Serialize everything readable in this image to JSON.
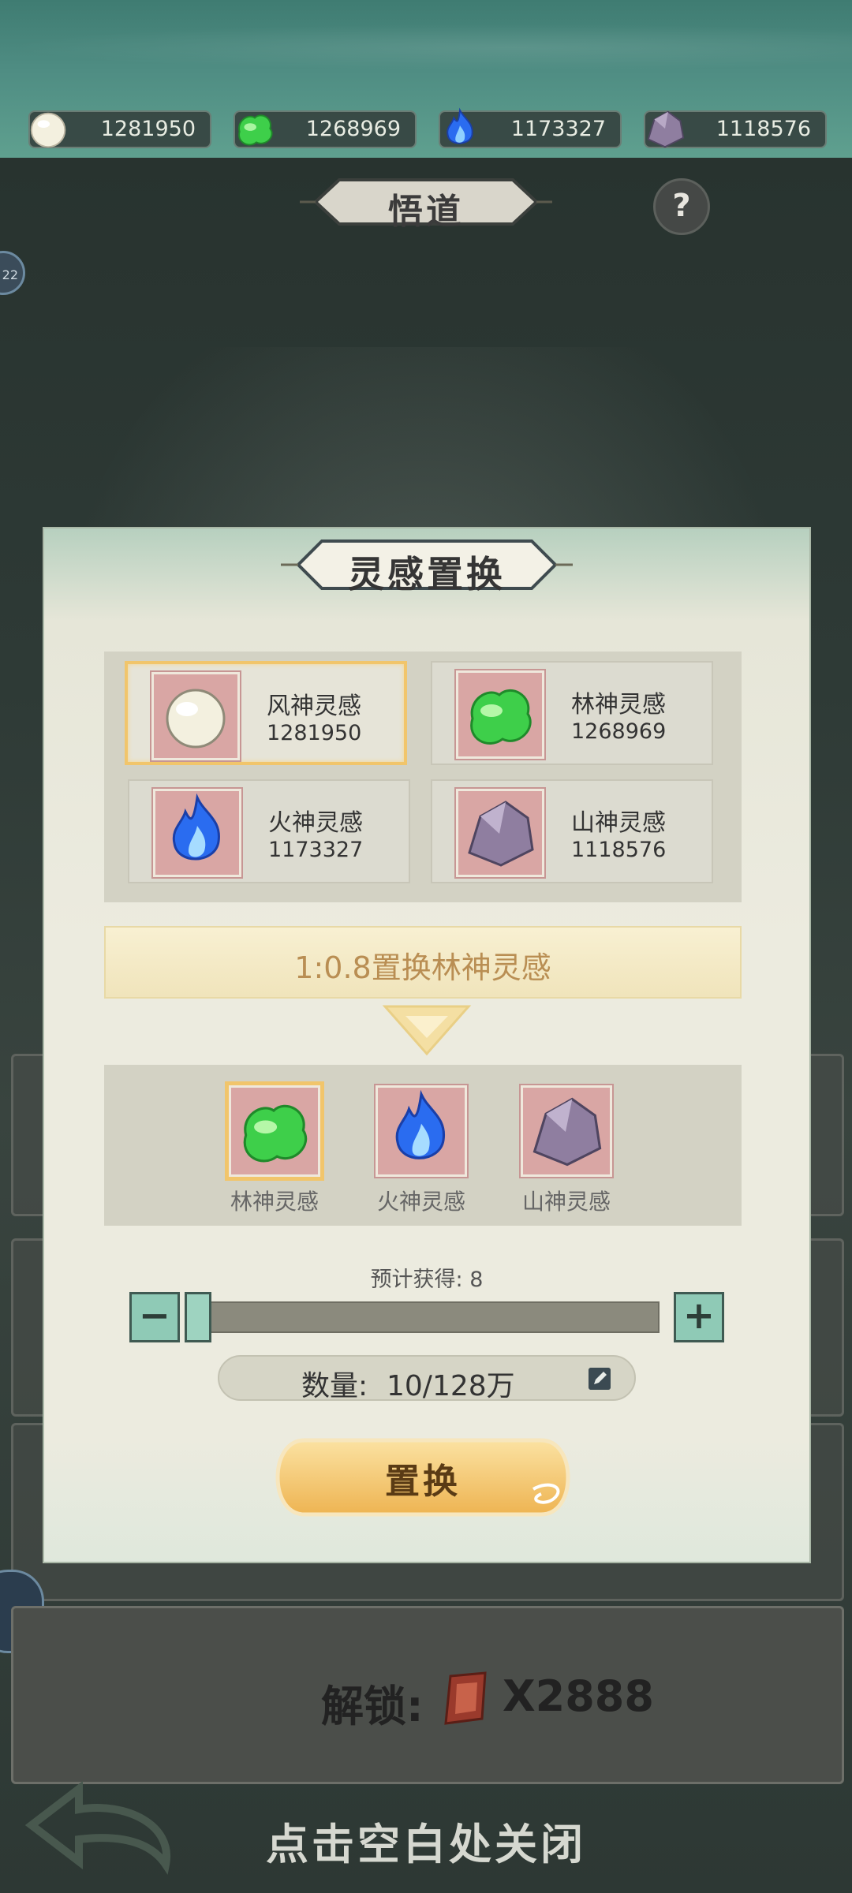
{
  "resources": [
    {
      "icon": "white-pearl-icon",
      "value": "1281950"
    },
    {
      "icon": "green-jade-icon",
      "value": "1268969"
    },
    {
      "icon": "blue-flame-icon",
      "value": "1173327"
    },
    {
      "icon": "purple-rock-icon",
      "value": "1118576"
    }
  ],
  "page": {
    "title": "悟道",
    "help_label": "?"
  },
  "modal": {
    "title": "灵感置换",
    "sources": [
      {
        "name": "风神灵感",
        "count": "1281950",
        "icon": "white-pearl-icon"
      },
      {
        "name": "林神灵感",
        "count": "1268969",
        "icon": "green-jade-icon"
      },
      {
        "name": "火神灵感",
        "count": "1173327",
        "icon": "blue-flame-icon"
      },
      {
        "name": "山神灵感",
        "count": "1118576",
        "icon": "purple-rock-icon"
      }
    ],
    "selected_source": 0,
    "rate_text": "1:0.8置换林神灵感",
    "targets": [
      {
        "name": "林神灵感",
        "icon": "green-jade-icon"
      },
      {
        "name": "火神灵感",
        "icon": "blue-flame-icon"
      },
      {
        "name": "山神灵感",
        "icon": "purple-rock-icon"
      }
    ],
    "selected_target": 0,
    "expected_label": "预计获得: 8",
    "minus_label": "−",
    "plus_label": "+",
    "quantity_label": "数量:",
    "quantity_value": "10/128万",
    "slider_fraction": 0.0,
    "exchange_label": "置换"
  },
  "background": {
    "unlock_label": "解锁:",
    "unlock_cost": "X2888"
  },
  "close_hint": "点击空白处关闭",
  "colors": {
    "accent_gold": "#f1c56b",
    "panel_bg": "#ecebdf",
    "teal": "#8fcab6"
  }
}
